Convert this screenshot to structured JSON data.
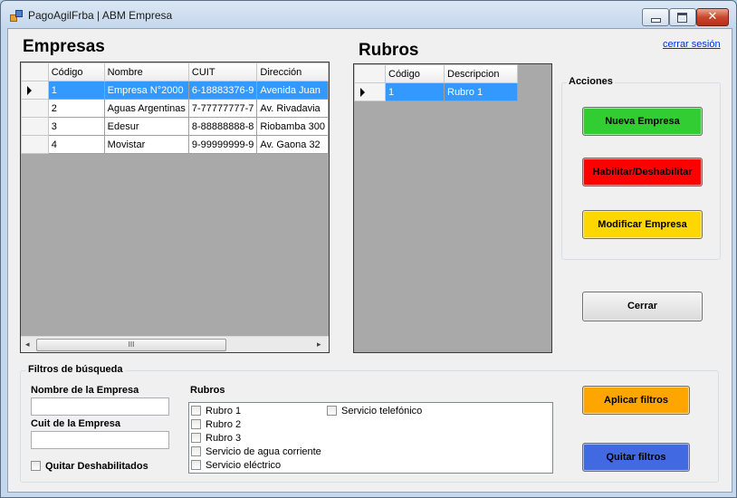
{
  "window": {
    "title": "PagoAgilFrba | ABM Empresa",
    "close_glyph": "✕"
  },
  "header": {
    "empresas_title": "Empresas",
    "rubros_title": "Rubros",
    "logout_link": "cerrar sesión"
  },
  "empresas_grid": {
    "columns": [
      "Código",
      "Nombre",
      "CUIT",
      "Dirección"
    ],
    "rows": [
      {
        "codigo": "1",
        "nombre": "Empresa N°2000",
        "cuit": "6-18883376-9",
        "direccion": "Avenida Juan"
      },
      {
        "codigo": "2",
        "nombre": "Aguas Argentinas",
        "cuit": "7-77777777-7",
        "direccion": "Av. Rivadavia"
      },
      {
        "codigo": "3",
        "nombre": "Edesur",
        "cuit": "8-88888888-8",
        "direccion": "Riobamba 300"
      },
      {
        "codigo": "4",
        "nombre": "Movistar",
        "cuit": "9-99999999-9",
        "direccion": "Av. Gaona 32"
      }
    ],
    "selected_row": 0,
    "scroll_thumb_label": "III"
  },
  "rubros_grid": {
    "columns": [
      "Código",
      "Descripcion"
    ],
    "rows": [
      {
        "codigo": "1",
        "descripcion": "Rubro 1"
      }
    ],
    "selected_row": 0
  },
  "acciones": {
    "title": "Acciones",
    "nueva_label": "Nueva Empresa",
    "habilitar_label": "Habilitar/Deshabilitar",
    "modificar_label": "Modificar Empresa"
  },
  "cerrar_label": "Cerrar",
  "filtros": {
    "title": "Filtros de búsqueda",
    "nombre_label": "Nombre de la Empresa",
    "nombre_value": "",
    "cuit_label": "Cuit de la Empresa",
    "cuit_value": "",
    "quitar_deshabilitados_label": "Quitar Deshabilitados",
    "rubros_label": "Rubros",
    "rubros_items": [
      "Rubro 1",
      "Rubro 2",
      "Rubro 3",
      "Servicio de agua corriente",
      "Servicio eléctrico",
      "Servicio telefónico"
    ],
    "aplicar_label": "Aplicar filtros",
    "quitar_label": "Quitar filtros"
  },
  "colors": {
    "nueva": "#32cd32",
    "habilitar": "#ff0000",
    "modificar": "#ffd700",
    "aplicar": "#ffa500",
    "quitar": "#4169e1",
    "selection": "#3399ff"
  }
}
